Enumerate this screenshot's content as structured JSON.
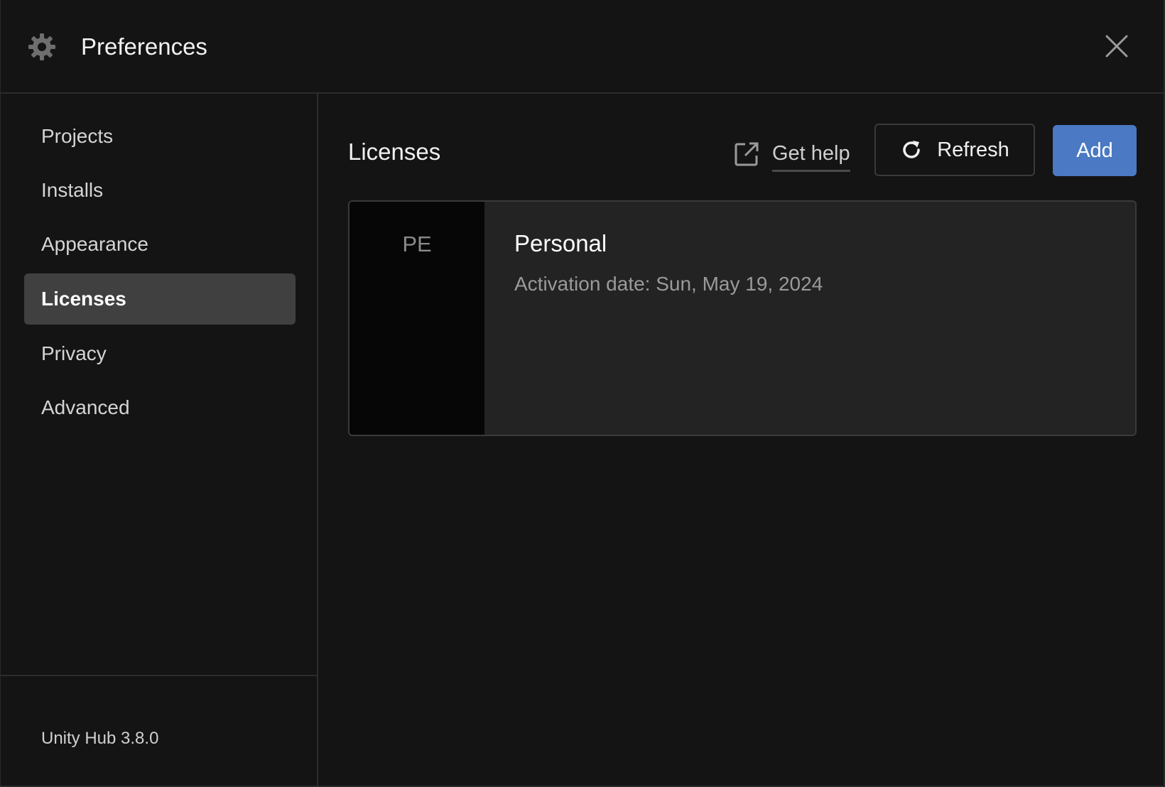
{
  "window": {
    "title": "Preferences",
    "title_icon": "gear-icon",
    "close_icon": "close-icon"
  },
  "sidebar": {
    "items": [
      {
        "label": "Projects",
        "active": false
      },
      {
        "label": "Installs",
        "active": false
      },
      {
        "label": "Appearance",
        "active": false
      },
      {
        "label": "Licenses",
        "active": true
      },
      {
        "label": "Privacy",
        "active": false
      },
      {
        "label": "Advanced",
        "active": false
      }
    ],
    "version": "Unity Hub 3.8.0"
  },
  "main": {
    "title": "Licenses",
    "get_help_label": "Get help",
    "get_help_icon": "external-link-icon",
    "refresh_label": "Refresh",
    "refresh_icon": "refresh-icon",
    "add_label": "Add",
    "licenses": [
      {
        "badge": "PE",
        "name": "Personal",
        "activation": "Activation date: Sun, May 19, 2024"
      }
    ]
  },
  "colors": {
    "background": "#141414",
    "active_nav": "#404040",
    "accent_button": "#4b79c3",
    "card": "#232323",
    "badge": "#060606"
  }
}
